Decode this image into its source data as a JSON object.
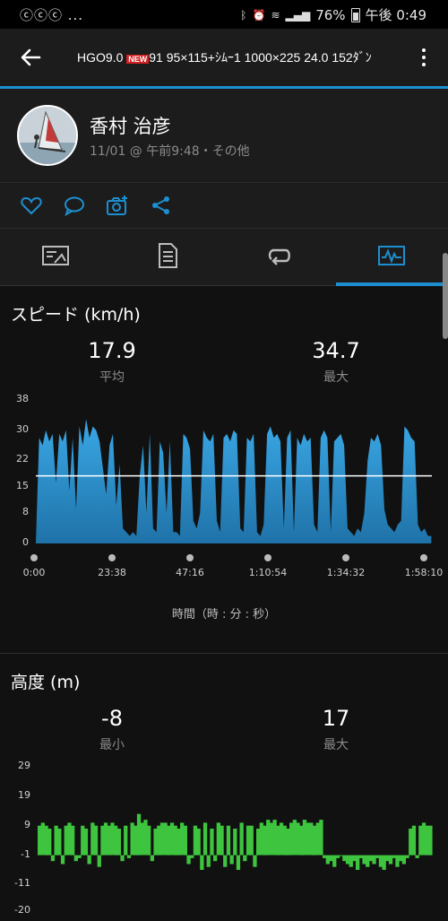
{
  "status_bar": {
    "left_icons": "ⓒⓒⓒ ...",
    "battery": "76%",
    "time": "午後 0:49"
  },
  "app_bar": {
    "title_part1": "HGO9.0 ",
    "badge": "NEW",
    "title_part2": "91  95×115+ｼﾑｰ1  1000×225  24.0  152ﾀﾞﾝ"
  },
  "profile": {
    "name": "香村 治彦",
    "subtitle": "11/01 @ 午前9:48・その他"
  },
  "actions": [
    "heart-icon",
    "comment-icon",
    "camera-add-icon",
    "share-icon"
  ],
  "tabs": [
    "summary-tab-icon",
    "details-tab-icon",
    "laps-tab-icon",
    "charts-tab-icon"
  ],
  "active_tab": 3,
  "colors": {
    "accent": "#1d8fd0",
    "speed": "#2d9ad8",
    "elevation": "#3ec43e"
  },
  "speed": {
    "title": "スピード (km/h)",
    "avg_value": "17.9",
    "avg_label": "平均",
    "max_value": "34.7",
    "max_label": "最大",
    "x_caption": "時間（時 : 分 : 秒）"
  },
  "elevation": {
    "title": "高度 (m)",
    "min_value": "-8",
    "min_label": "最小",
    "max_value": "17",
    "max_label": "最大"
  },
  "chart_data": [
    {
      "type": "area",
      "title": "スピード (km/h)",
      "xlabel": "時間（時 : 分 : 秒）",
      "ylabel": "",
      "x_ticks": [
        "0:00",
        "23:38",
        "47:16",
        "1:10:54",
        "1:34:32",
        "1:58:10"
      ],
      "y_ticks": [
        0,
        8,
        15,
        22,
        30,
        38
      ],
      "ylim": [
        0,
        38
      ],
      "xlim_minutes": [
        0,
        118.17
      ],
      "average_line": 17.9,
      "series": [
        {
          "values": [
            [
              0,
              0
            ],
            [
              1,
              28
            ],
            [
              2,
              26
            ],
            [
              3,
              30
            ],
            [
              4,
              27
            ],
            [
              5,
              29
            ],
            [
              6,
              16
            ],
            [
              7,
              29
            ],
            [
              8,
              27
            ],
            [
              9,
              30
            ],
            [
              10,
              14
            ],
            [
              11,
              28
            ],
            [
              12,
              9
            ],
            [
              13,
              31
            ],
            [
              14,
              26
            ],
            [
              15,
              33
            ],
            [
              16,
              28
            ],
            [
              17,
              31
            ],
            [
              18,
              30
            ],
            [
              19,
              27
            ],
            [
              20,
              20
            ],
            [
              21,
              13
            ],
            [
              22,
              26
            ],
            [
              23,
              29
            ],
            [
              24,
              10
            ],
            [
              25,
              21
            ],
            [
              26,
              4
            ],
            [
              27,
              3
            ],
            [
              28,
              2
            ],
            [
              29,
              3
            ],
            [
              30,
              2
            ],
            [
              31,
              18
            ],
            [
              32,
              26
            ],
            [
              33,
              8
            ],
            [
              34,
              29
            ],
            [
              35,
              4
            ],
            [
              36,
              3
            ],
            [
              37,
              27
            ],
            [
              38,
              24
            ],
            [
              39,
              8
            ],
            [
              40,
              27
            ],
            [
              41,
              3
            ],
            [
              42,
              3
            ],
            [
              43,
              2
            ],
            [
              44,
              29
            ],
            [
              45,
              28
            ],
            [
              46,
              25
            ],
            [
              47,
              6
            ],
            [
              48,
              4
            ],
            [
              49,
              8
            ],
            [
              50,
              30
            ],
            [
              51,
              28
            ],
            [
              52,
              27
            ],
            [
              53,
              29
            ],
            [
              54,
              6
            ],
            [
              55,
              3
            ],
            [
              56,
              28
            ],
            [
              57,
              29
            ],
            [
              58,
              27
            ],
            [
              59,
              30
            ],
            [
              60,
              29
            ],
            [
              61,
              4
            ],
            [
              62,
              3
            ],
            [
              63,
              28
            ],
            [
              64,
              27
            ],
            [
              65,
              29
            ],
            [
              66,
              3
            ],
            [
              67,
              2
            ],
            [
              68,
              5
            ],
            [
              69,
              29
            ],
            [
              70,
              31
            ],
            [
              71,
              28
            ],
            [
              72,
              29
            ],
            [
              73,
              27
            ],
            [
              74,
              4
            ],
            [
              75,
              28
            ],
            [
              76,
              30
            ],
            [
              77,
              3
            ],
            [
              78,
              28
            ],
            [
              79,
              26
            ],
            [
              80,
              29
            ],
            [
              81,
              27
            ],
            [
              82,
              28
            ],
            [
              83,
              5
            ],
            [
              84,
              3
            ],
            [
              85,
              28
            ],
            [
              86,
              30
            ],
            [
              87,
              28
            ],
            [
              88,
              3
            ],
            [
              89,
              27
            ],
            [
              90,
              28
            ],
            [
              91,
              29
            ],
            [
              92,
              26
            ],
            [
              93,
              4
            ],
            [
              94,
              3
            ],
            [
              95,
              2
            ],
            [
              96,
              4
            ],
            [
              97,
              3
            ],
            [
              98,
              8
            ],
            [
              99,
              22
            ],
            [
              100,
              28
            ],
            [
              101,
              27
            ],
            [
              102,
              29
            ],
            [
              103,
              26
            ],
            [
              104,
              9
            ],
            [
              105,
              5
            ],
            [
              106,
              4
            ],
            [
              107,
              3
            ],
            [
              108,
              5
            ],
            [
              109,
              6
            ],
            [
              110,
              31
            ],
            [
              111,
              30
            ],
            [
              112,
              28
            ],
            [
              113,
              27
            ],
            [
              114,
              5
            ],
            [
              115,
              3
            ],
            [
              116,
              4
            ],
            [
              117,
              2
            ],
            [
              118,
              2
            ]
          ]
        }
      ]
    },
    {
      "type": "bar",
      "title": "高度 (m)",
      "y_ticks": [
        -20,
        -11,
        -1,
        9,
        19,
        29
      ],
      "ylim": [
        -20,
        29
      ],
      "baseline": -1,
      "series": [
        {
          "values": [
            [
              0,
              9
            ],
            [
              1,
              10
            ],
            [
              2,
              9
            ],
            [
              3,
              8
            ],
            [
              4,
              -3
            ],
            [
              5,
              9
            ],
            [
              6,
              8
            ],
            [
              7,
              -4
            ],
            [
              8,
              9
            ],
            [
              9,
              10
            ],
            [
              10,
              9
            ],
            [
              11,
              -3
            ],
            [
              12,
              -2
            ],
            [
              13,
              9
            ],
            [
              14,
              8
            ],
            [
              15,
              -4
            ],
            [
              16,
              10
            ],
            [
              17,
              9
            ],
            [
              18,
              -5
            ],
            [
              19,
              9
            ],
            [
              20,
              10
            ],
            [
              21,
              9
            ],
            [
              22,
              10
            ],
            [
              23,
              9
            ],
            [
              24,
              8
            ],
            [
              25,
              -3
            ],
            [
              26,
              9
            ],
            [
              27,
              -2
            ],
            [
              28,
              10
            ],
            [
              29,
              9
            ],
            [
              30,
              13
            ],
            [
              31,
              10
            ],
            [
              32,
              11
            ],
            [
              33,
              9
            ],
            [
              34,
              -3
            ],
            [
              35,
              8
            ],
            [
              36,
              9
            ],
            [
              37,
              10
            ],
            [
              38,
              10
            ],
            [
              39,
              9
            ],
            [
              40,
              10
            ],
            [
              41,
              9
            ],
            [
              42,
              8
            ],
            [
              43,
              10
            ],
            [
              44,
              9
            ],
            [
              45,
              -4
            ],
            [
              46,
              -2
            ],
            [
              47,
              9
            ],
            [
              48,
              8
            ],
            [
              49,
              -6
            ],
            [
              50,
              10
            ],
            [
              51,
              -5
            ],
            [
              52,
              8
            ],
            [
              53,
              -3
            ],
            [
              54,
              10
            ],
            [
              55,
              9
            ],
            [
              56,
              -5
            ],
            [
              57,
              9
            ],
            [
              58,
              -4
            ],
            [
              59,
              8
            ],
            [
              60,
              -6
            ],
            [
              61,
              10
            ],
            [
              62,
              -3
            ],
            [
              63,
              9
            ],
            [
              64,
              9
            ],
            [
              65,
              -5
            ],
            [
              66,
              8
            ],
            [
              67,
              10
            ],
            [
              68,
              9
            ],
            [
              69,
              11
            ],
            [
              70,
              10
            ],
            [
              71,
              11
            ],
            [
              72,
              9
            ],
            [
              73,
              10
            ],
            [
              74,
              9
            ],
            [
              75,
              8
            ],
            [
              76,
              10
            ],
            [
              77,
              11
            ],
            [
              78,
              10
            ],
            [
              79,
              9
            ],
            [
              80,
              11
            ],
            [
              81,
              10
            ],
            [
              82,
              10
            ],
            [
              83,
              9
            ],
            [
              84,
              10
            ],
            [
              85,
              11
            ],
            [
              86,
              -2
            ],
            [
              87,
              -4
            ],
            [
              88,
              -3
            ],
            [
              89,
              -5
            ],
            [
              90,
              -2
            ],
            [
              91,
              -1
            ],
            [
              92,
              -3
            ],
            [
              93,
              -4
            ],
            [
              94,
              -5
            ],
            [
              95,
              -3
            ],
            [
              96,
              -6
            ],
            [
              97,
              -2
            ],
            [
              98,
              -4
            ],
            [
              99,
              -5
            ],
            [
              100,
              -3
            ],
            [
              101,
              -4
            ],
            [
              102,
              -2
            ],
            [
              103,
              -5
            ],
            [
              104,
              -6
            ],
            [
              105,
              -3
            ],
            [
              106,
              -4
            ],
            [
              107,
              -2
            ],
            [
              108,
              -5
            ],
            [
              109,
              -3
            ],
            [
              110,
              -4
            ],
            [
              111,
              -2
            ],
            [
              112,
              8
            ],
            [
              113,
              9
            ],
            [
              114,
              -2
            ],
            [
              115,
              9
            ],
            [
              116,
              10
            ],
            [
              117,
              9
            ],
            [
              118,
              9
            ]
          ]
        }
      ]
    }
  ]
}
